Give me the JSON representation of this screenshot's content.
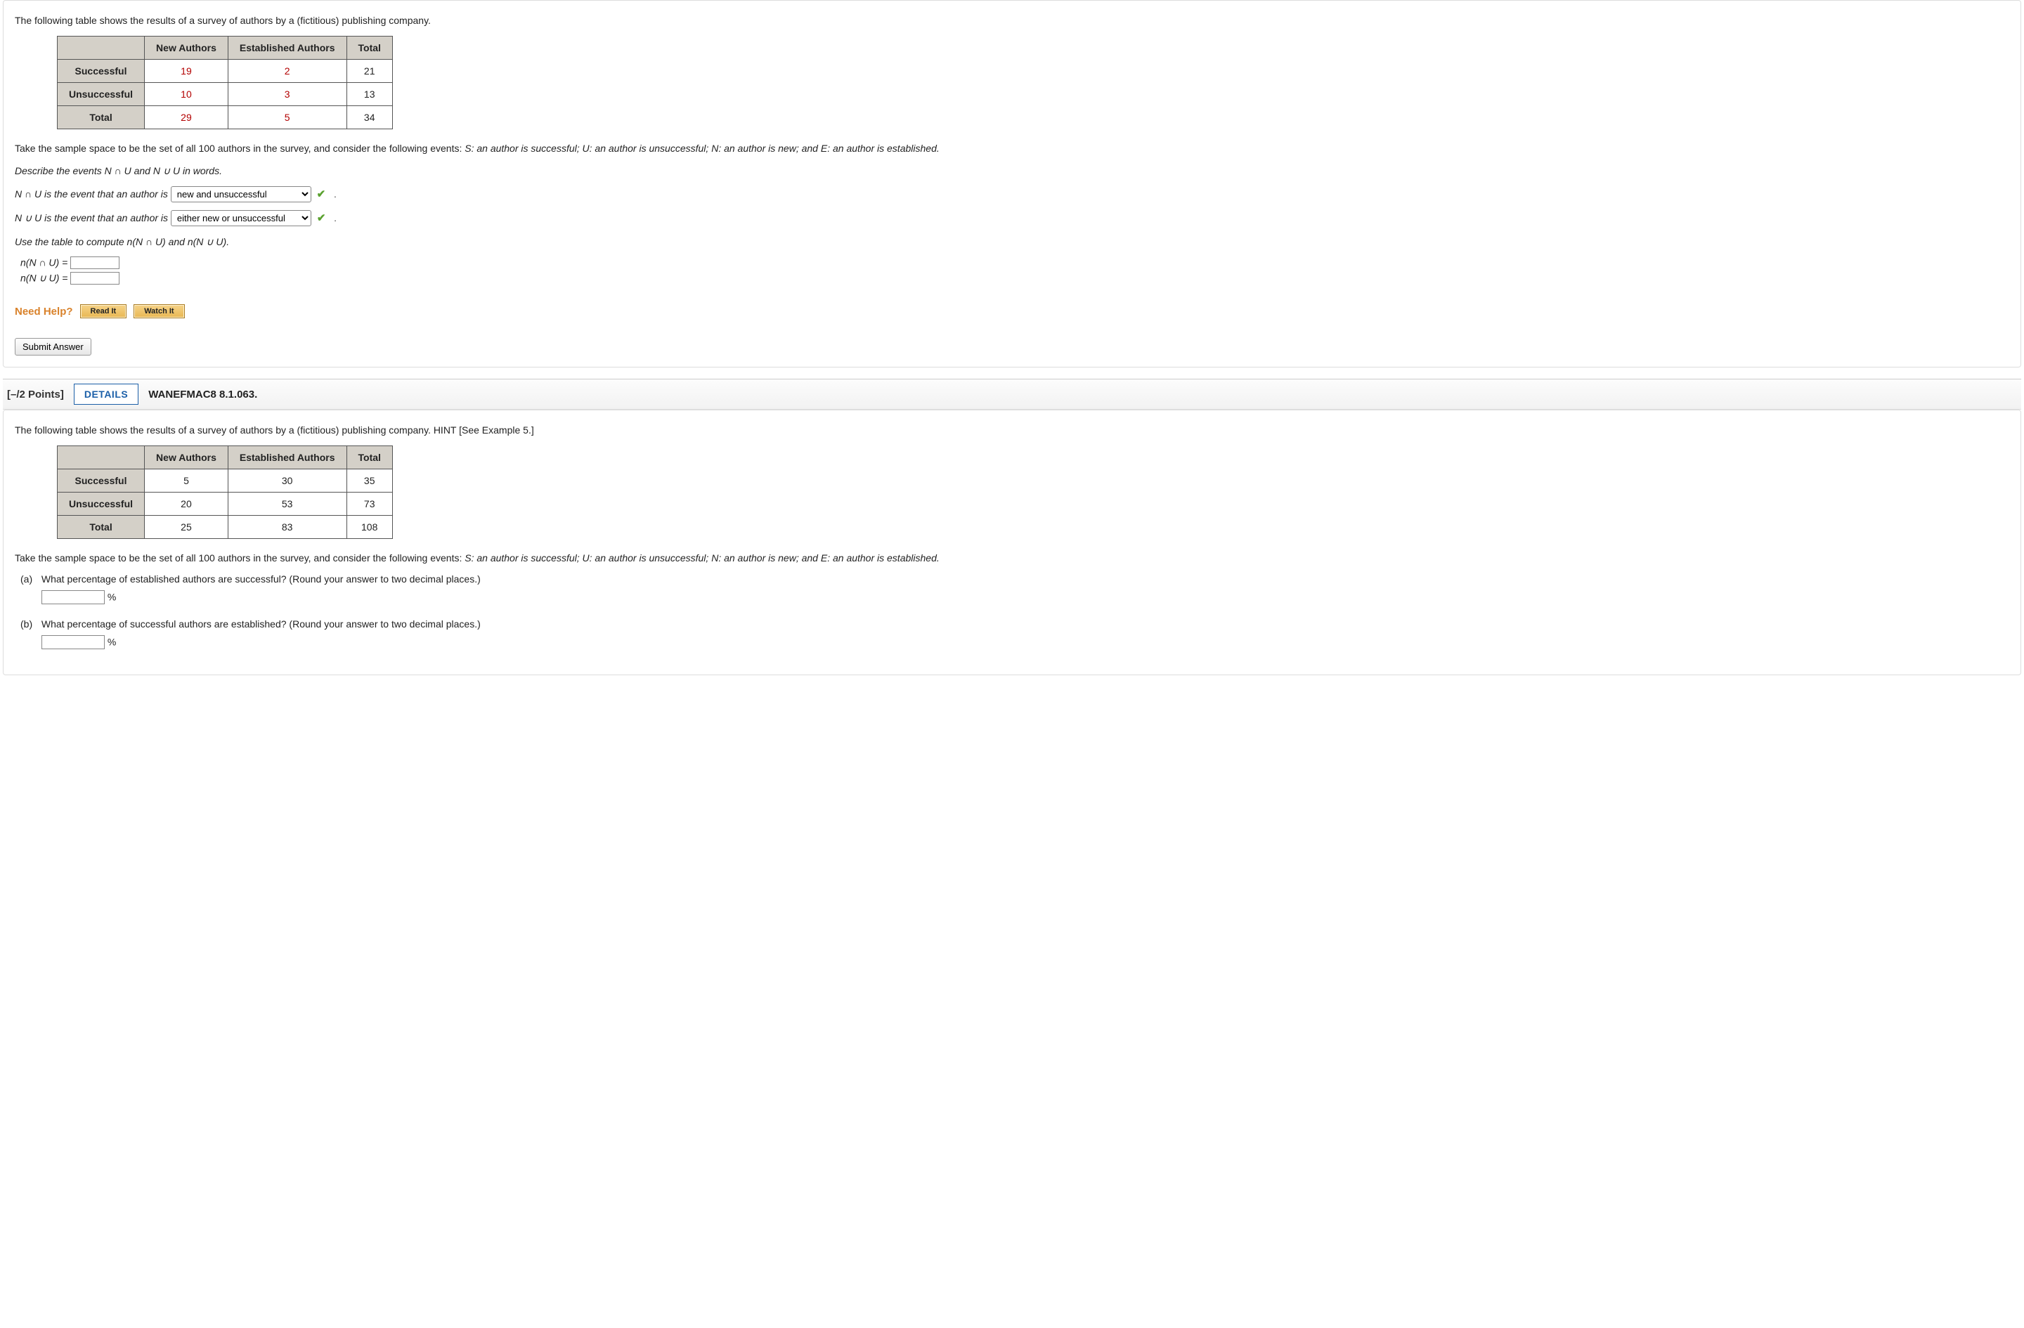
{
  "q1": {
    "intro": "The following table shows the results of a survey of authors by a (fictitious) publishing company.",
    "table": {
      "headers": [
        "",
        "New Authors",
        "Established Authors",
        "Total"
      ],
      "rows": [
        {
          "h": "Successful",
          "c": [
            "19",
            "2",
            "21"
          ]
        },
        {
          "h": "Unsuccessful",
          "c": [
            "10",
            "3",
            "13"
          ]
        },
        {
          "h": "Total",
          "c": [
            "29",
            "5",
            "34"
          ]
        }
      ]
    },
    "sample_space": "Take the sample space to be the set of all 100 authors in the survey, and consider the following events: ",
    "events_def_s": "S: an author is successful; ",
    "events_def_u": "U: an author is unsuccessful; ",
    "events_def_n": "N: an author is new; and ",
    "events_def_e": "E: an author is established.",
    "describe": "Describe the events N ∩ U and N ∪ U in words.",
    "line1_prefix": "N ∩ U is the event that an author is ",
    "select1_value": "new and unsuccessful",
    "line2_prefix": "N ∪ U is the event that an author is ",
    "select2_value": "either new or unsuccessful",
    "compute_prompt": "Use the table to compute n(N ∩ U) and n(N ∪ U).",
    "eq1": "n(N ∩ U)  =",
    "eq2": "n(N ∪ U)  =",
    "need_help": "Need Help?",
    "read_it": "Read It",
    "watch_it": "Watch It",
    "submit": "Submit Answer"
  },
  "q2": {
    "points": "[–/2 Points]",
    "details": "DETAILS",
    "ref": "WANEFMAC8 8.1.063.",
    "intro": "The following table shows the results of a survey of authors by a (fictitious) publishing company. HINT [See Example 5.]",
    "table": {
      "headers": [
        "",
        "New Authors",
        "Established Authors",
        "Total"
      ],
      "rows": [
        {
          "h": "Successful",
          "c": [
            "5",
            "30",
            "35"
          ]
        },
        {
          "h": "Unsuccessful",
          "c": [
            "20",
            "53",
            "73"
          ]
        },
        {
          "h": "Total",
          "c": [
            "25",
            "83",
            "108"
          ]
        }
      ]
    },
    "sample_space": "Take the sample space to be the set of all 100 authors in the survey, and consider the following events: ",
    "events_def_s": "S: an author is successful; ",
    "events_def_u": "U: an author is unsuccessful; ",
    "events_def_n": "N: an author is new; and ",
    "events_def_e": "E: an author is established.",
    "part_a_label": "(a)",
    "part_a": "What percentage of established authors are successful? (Round your answer to two decimal places.)",
    "part_b_label": "(b)",
    "part_b": "What percentage of successful authors are established? (Round your answer to two decimal places.)",
    "percent": "%"
  }
}
